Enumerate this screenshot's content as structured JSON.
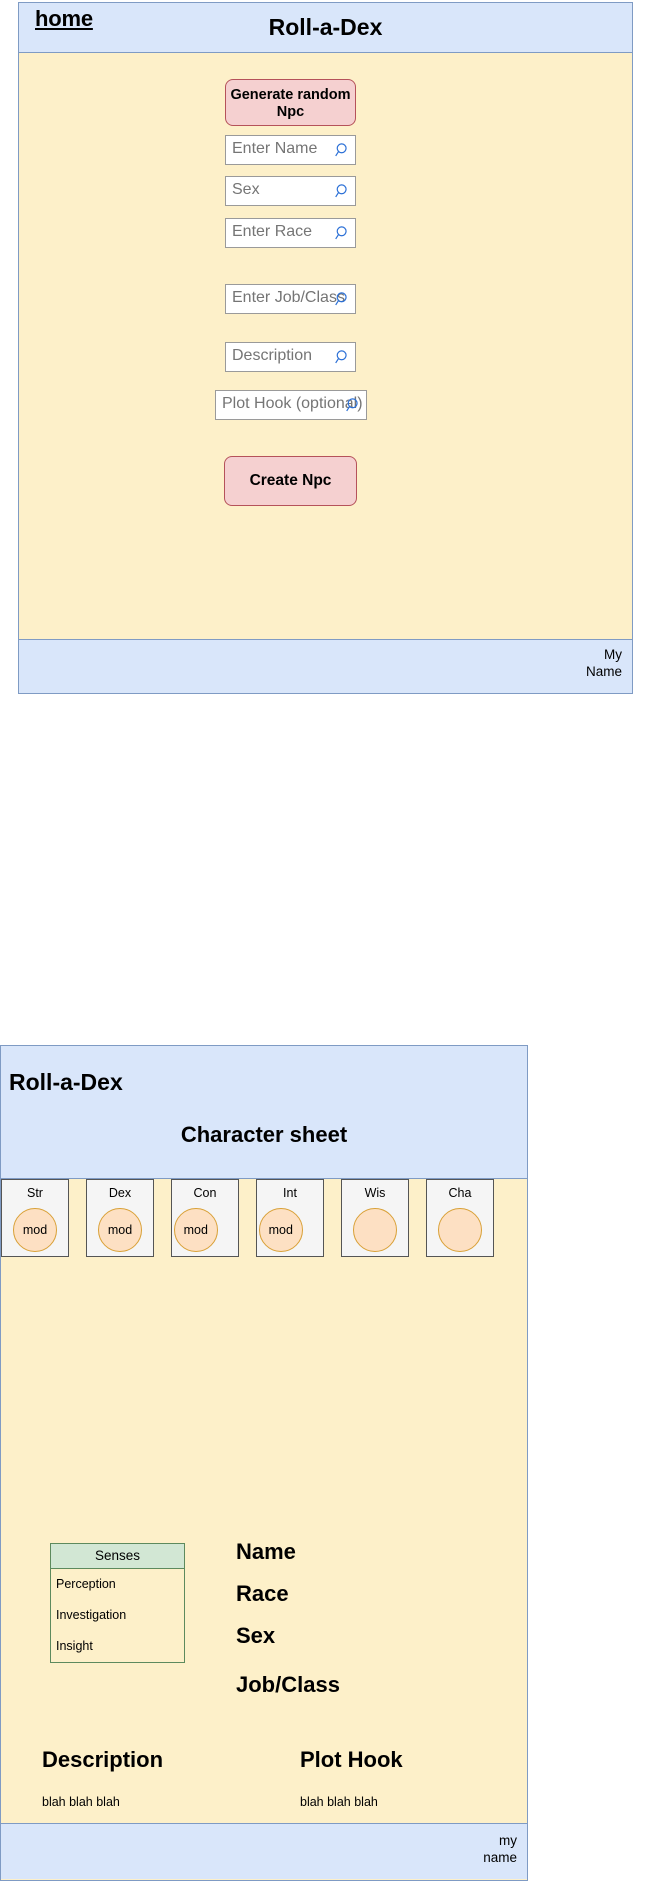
{
  "creator": {
    "header": {
      "home_label": "home",
      "title": "Roll-a-Dex"
    },
    "generate_button": "Generate random Npc",
    "fields": [
      {
        "key": "name",
        "placeholder": "Enter Name",
        "value": "",
        "icon": "search-icon"
      },
      {
        "key": "sex",
        "placeholder": "Sex",
        "value": "",
        "icon": "search-icon"
      },
      {
        "key": "race",
        "placeholder": "Enter Race",
        "value": "",
        "icon": "search-icon"
      },
      {
        "key": "job",
        "placeholder": "Enter Job/Class",
        "value": "",
        "icon": "search-icon"
      },
      {
        "key": "description",
        "placeholder": "Description",
        "value": "",
        "icon": "search-icon"
      },
      {
        "key": "plot_hook",
        "placeholder": "Plot Hook (optional)",
        "value": "",
        "icon": "search-icon"
      }
    ],
    "create_button": "Create Npc",
    "footer": {
      "line1": "My",
      "line2": "Name"
    }
  },
  "sheet": {
    "header": {
      "brand": "Roll-a-Dex",
      "subtitle": "Character sheet"
    },
    "stats": [
      {
        "label": "Str",
        "mod": "mod"
      },
      {
        "label": "Dex",
        "mod": "mod"
      },
      {
        "label": "Con",
        "mod": "mod"
      },
      {
        "label": "Int",
        "mod": "mod"
      },
      {
        "label": "Wis",
        "mod": ""
      },
      {
        "label": "Cha",
        "mod": ""
      }
    ],
    "senses": {
      "title": "Senses",
      "rows": [
        "Perception",
        "Investigation",
        "Insight"
      ]
    },
    "info": {
      "name": "Name",
      "race": "Race",
      "sex": "Sex",
      "job": "Job/Class"
    },
    "description": {
      "title": "Description",
      "text": "blah blah blah"
    },
    "plot_hook": {
      "title": "Plot Hook",
      "text": "blah blah blah"
    },
    "footer": {
      "line1": "my",
      "line2": "name"
    }
  },
  "colors": {
    "header_blue": "#d9e6fa",
    "body_cream": "#fdf0c9",
    "button_pink": "#f5d0d0",
    "button_border": "#b5525a",
    "senses_green": "#d2e7d4",
    "circle_orange": "#fde0c3",
    "icon_blue": "#2a6fd6"
  }
}
